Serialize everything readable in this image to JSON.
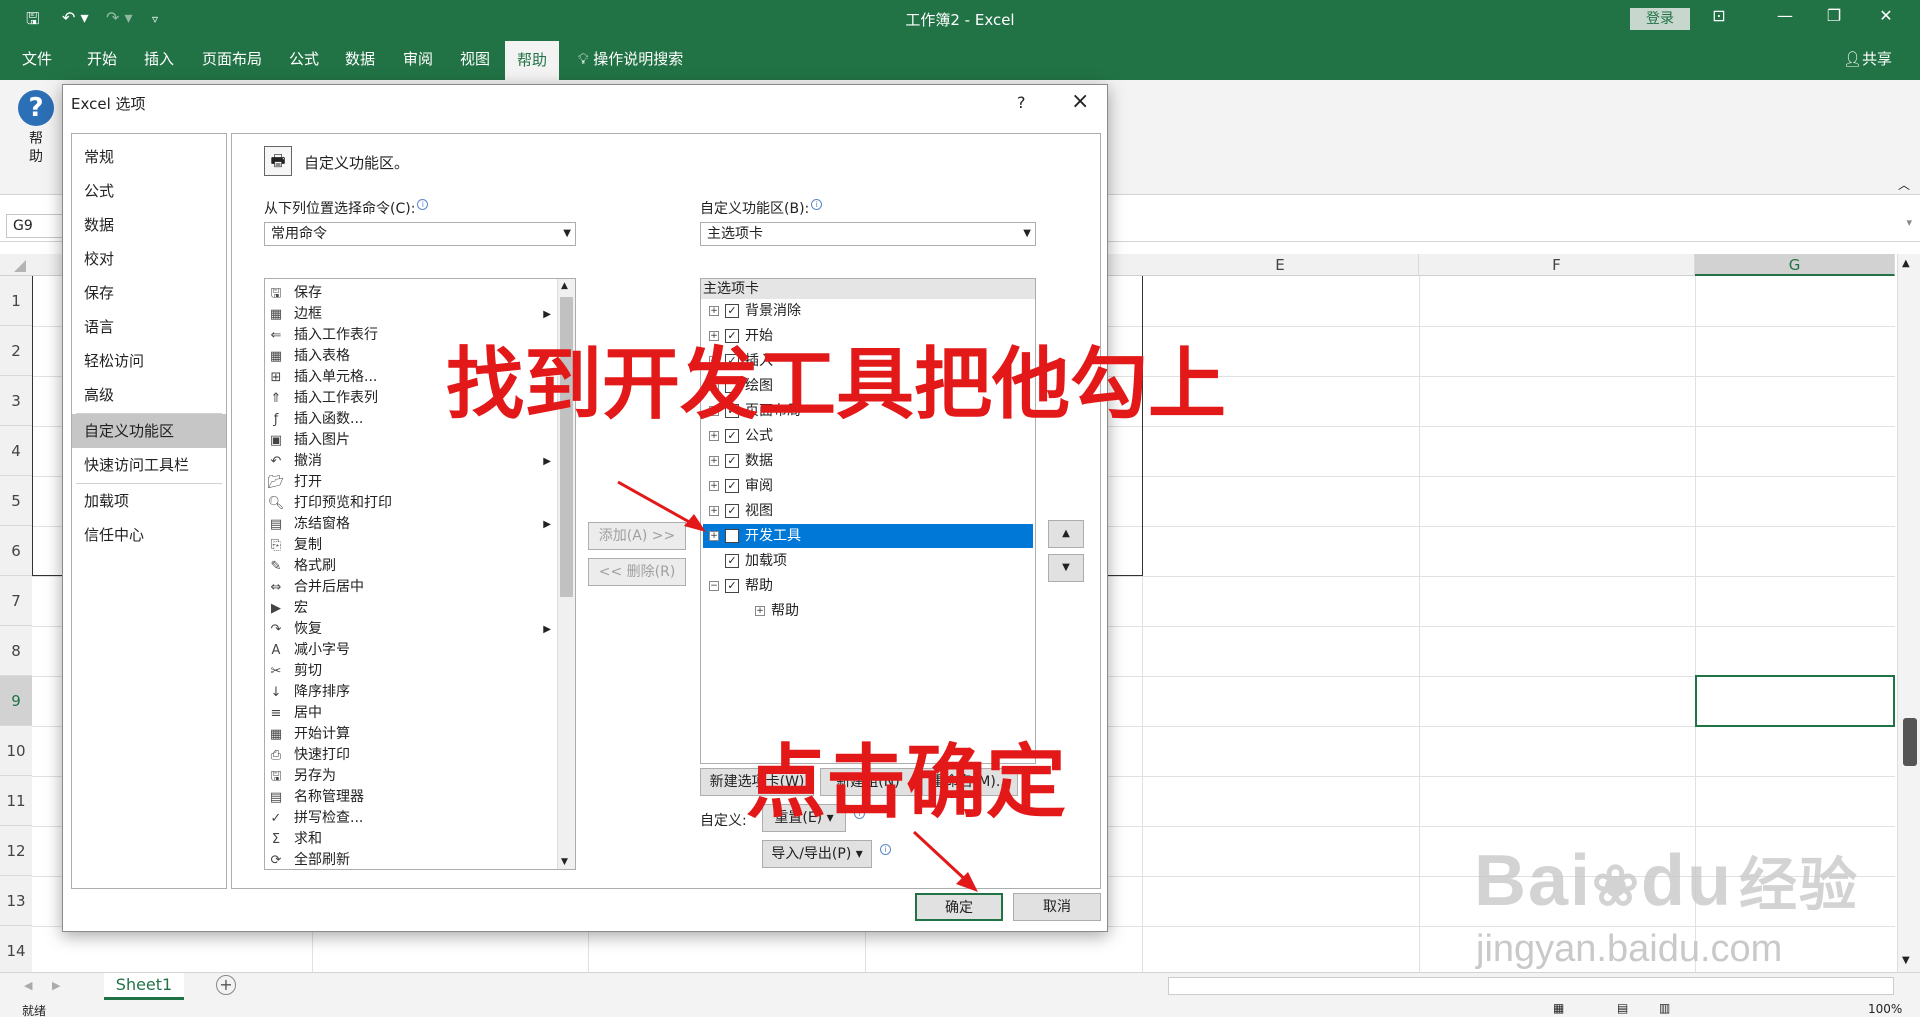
{
  "window": {
    "title": "工作簿2  -  Excel",
    "login": "登录"
  },
  "ribbon": {
    "tabs": [
      "文件",
      "开始",
      "插入",
      "页面布局",
      "公式",
      "数据",
      "审阅",
      "视图",
      "帮助"
    ],
    "active_tab": "帮助",
    "search": "操作说明搜索",
    "share": "共享",
    "help_button": "帮助"
  },
  "formula_bar": {
    "name_box": "G9"
  },
  "grid": {
    "columns": [
      "E",
      "F",
      "G"
    ],
    "rows": [
      "1",
      "2",
      "3",
      "4",
      "5",
      "6",
      "7",
      "8",
      "9",
      "10",
      "11",
      "12",
      "13",
      "14"
    ]
  },
  "sheet": {
    "tab": "Sheet1"
  },
  "status": {
    "ready": "就绪",
    "zoom": "100%"
  },
  "dialog": {
    "title": "Excel 选项",
    "help": "?",
    "close": "×",
    "nav": [
      "常规",
      "公式",
      "数据",
      "校对",
      "保存",
      "语言",
      "轻松访问",
      "高级",
      "自定义功能区",
      "快速访问工具栏",
      "加载项",
      "信任中心"
    ],
    "nav_selected": "自定义功能区",
    "heading": "自定义功能区。",
    "choose_label": "从下列位置选择命令(C):",
    "choose_value": "常用命令",
    "customize_label": "自定义功能区(B):",
    "customize_value": "主选项卡",
    "commands": [
      {
        "label": "保存",
        "icon": "save-icon"
      },
      {
        "label": "边框",
        "icon": "border-icon",
        "sub": true
      },
      {
        "label": "插入工作表行",
        "icon": "insert-row-icon"
      },
      {
        "label": "插入表格",
        "icon": "table-icon"
      },
      {
        "label": "插入单元格...",
        "icon": "insert-cell-icon"
      },
      {
        "label": "插入工作表列",
        "icon": "insert-column-icon"
      },
      {
        "label": "插入函数...",
        "icon": "function-icon"
      },
      {
        "label": "插入图片",
        "icon": "picture-icon"
      },
      {
        "label": "撤消",
        "icon": "undo-icon",
        "sub": true
      },
      {
        "label": "打开",
        "icon": "open-icon"
      },
      {
        "label": "打印预览和打印",
        "icon": "print-preview-icon"
      },
      {
        "label": "冻结窗格",
        "icon": "freeze-icon",
        "sub": true
      },
      {
        "label": "复制",
        "icon": "copy-icon"
      },
      {
        "label": "格式刷",
        "icon": "format-painter-icon"
      },
      {
        "label": "合并后居中",
        "icon": "merge-icon"
      },
      {
        "label": "宏",
        "icon": "macro-icon"
      },
      {
        "label": "恢复",
        "icon": "redo-icon",
        "sub": true
      },
      {
        "label": "减小字号",
        "icon": "font-decrease-icon"
      },
      {
        "label": "剪切",
        "icon": "cut-icon"
      },
      {
        "label": "降序排序",
        "icon": "sort-desc-icon"
      },
      {
        "label": "居中",
        "icon": "center-icon"
      },
      {
        "label": "开始计算",
        "icon": "calculate-icon"
      },
      {
        "label": "快速打印",
        "icon": "quick-print-icon"
      },
      {
        "label": "另存为",
        "icon": "save-as-icon"
      },
      {
        "label": "名称管理器",
        "icon": "name-manager-icon"
      },
      {
        "label": "拼写检查...",
        "icon": "spell-check-icon"
      },
      {
        "label": "求和",
        "icon": "sum-icon"
      },
      {
        "label": "全部刷新",
        "icon": "refresh-icon"
      }
    ],
    "tree_header": "主选项卡",
    "tree": [
      {
        "label": "背景消除",
        "checked": true,
        "expand": "+",
        "level": 0
      },
      {
        "label": "开始",
        "checked": true,
        "expand": "+",
        "level": 0
      },
      {
        "label": "插入",
        "checked": true,
        "expand": "+",
        "level": 0
      },
      {
        "label": "绘图",
        "checked": false,
        "expand": "+",
        "level": 0
      },
      {
        "label": "页面布局",
        "checked": true,
        "expand": "+",
        "level": 0
      },
      {
        "label": "公式",
        "checked": true,
        "expand": "+",
        "level": 0
      },
      {
        "label": "数据",
        "checked": true,
        "expand": "+",
        "level": 0
      },
      {
        "label": "审阅",
        "checked": true,
        "expand": "+",
        "level": 0
      },
      {
        "label": "视图",
        "checked": true,
        "expand": "+",
        "level": 0
      },
      {
        "label": "开发工具",
        "checked": true,
        "expand": "+",
        "level": 0,
        "selected": true
      },
      {
        "label": "加载项",
        "checked": true,
        "expand": "",
        "level": 0
      },
      {
        "label": "帮助",
        "checked": true,
        "expand": "−",
        "level": 0
      },
      {
        "label": "帮助",
        "checked": null,
        "expand": "+",
        "level": 1
      }
    ],
    "add_button": "添加(A) >>",
    "remove_button": "<< 删除(R)",
    "new_tab_button": "新建选项卡(W)",
    "new_group_button": "新建组(N)",
    "rename_button": "重命名(M)...",
    "customize_caption": "自定义:",
    "reset_button": "重置(E) ▾",
    "import_export_button": "导入/导出(P) ▾",
    "ok_button": "确定",
    "cancel_button": "取消"
  },
  "annotations": {
    "find": "找到开发工具把他勾上",
    "click": "点击确定"
  },
  "watermark": {
    "brand": "Bai",
    "brand2": "du",
    "cn": "经验",
    "url": "jingyan.baidu.com"
  }
}
